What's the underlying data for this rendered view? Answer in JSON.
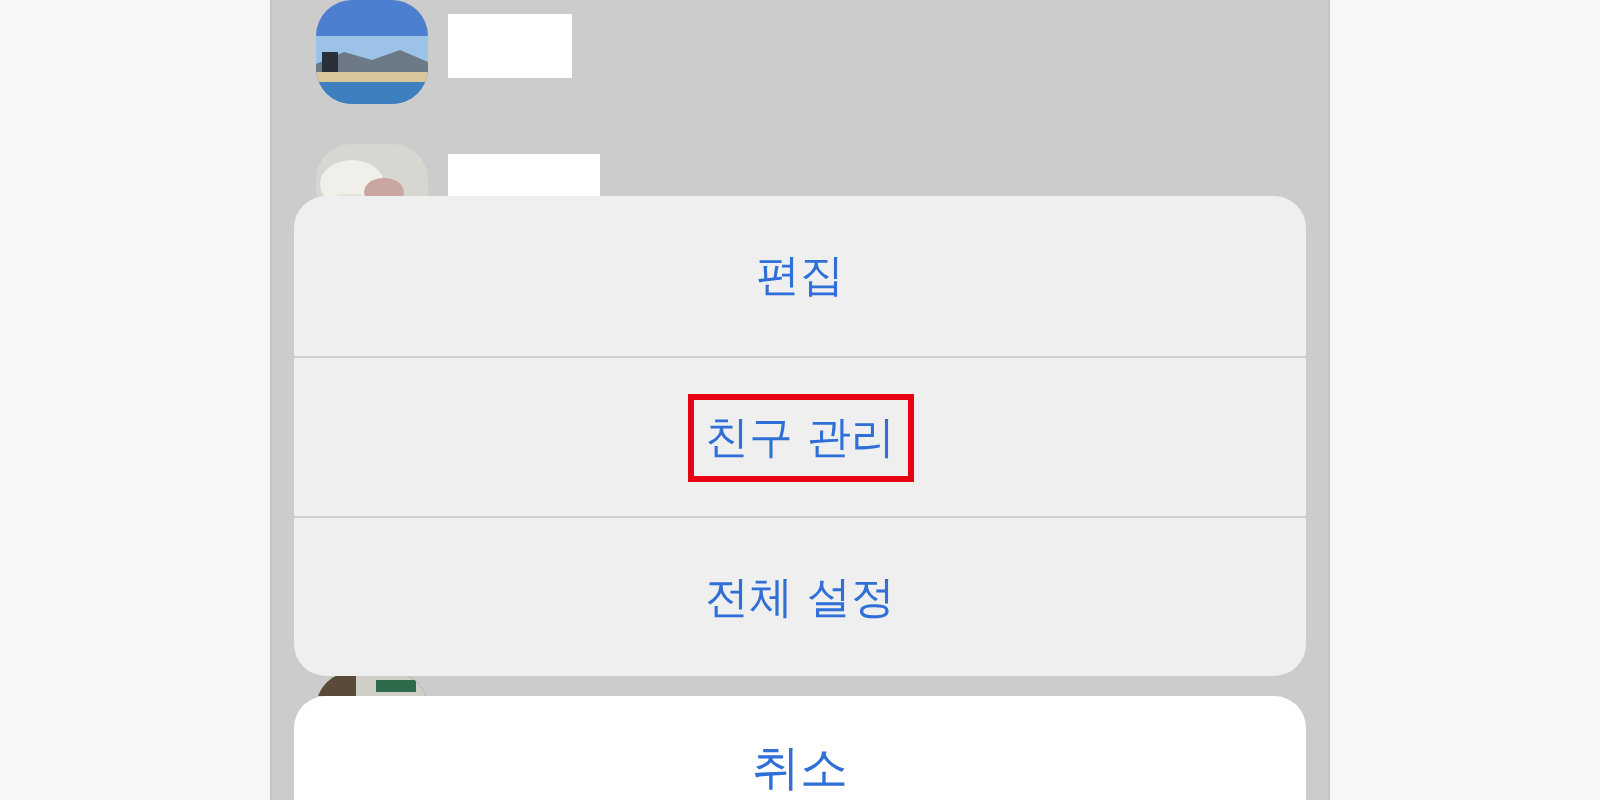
{
  "action_sheet": {
    "items": [
      {
        "label": "편집",
        "highlighted": false
      },
      {
        "label": "친구 관리",
        "highlighted": true
      },
      {
        "label": "전체 설정",
        "highlighted": false
      }
    ]
  },
  "cancel_button": {
    "label": "취소"
  }
}
